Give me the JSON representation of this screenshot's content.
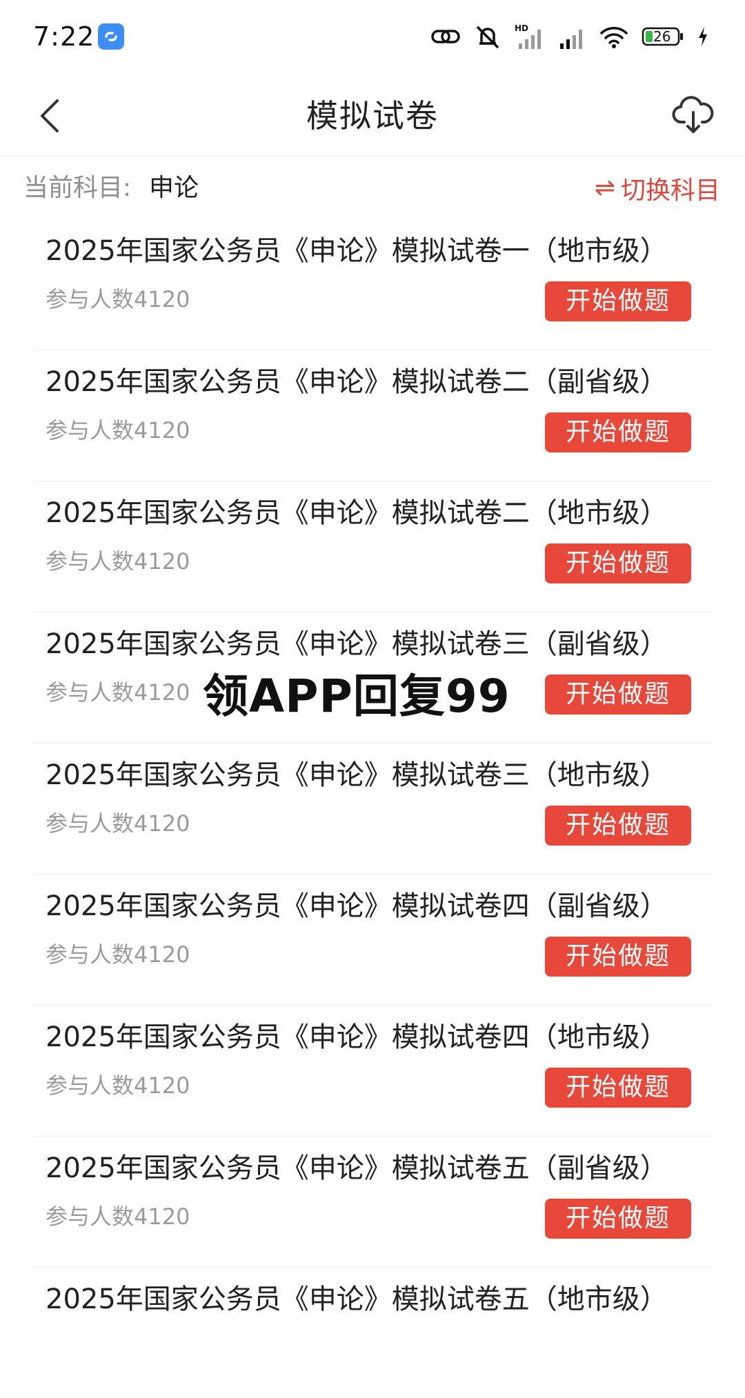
{
  "status_bar": {
    "time": "7:22",
    "battery": "26",
    "network": "HD"
  },
  "header": {
    "title": "模拟试卷"
  },
  "subject": {
    "label": "当前科目:",
    "value": "申论",
    "switch_icon": "⇌",
    "switch_label": "切换科目"
  },
  "exams": [
    {
      "title": "2025年国家公务员《申论》模拟试卷一（地市级）",
      "count": "参与人数4120",
      "button": "开始做题"
    },
    {
      "title": "2025年国家公务员《申论》模拟试卷二（副省级）",
      "count": "参与人数4120",
      "button": "开始做题"
    },
    {
      "title": "2025年国家公务员《申论》模拟试卷二（地市级）",
      "count": "参与人数4120",
      "button": "开始做题"
    },
    {
      "title": "2025年国家公务员《申论》模拟试卷三（副省级）",
      "count": "参与人数4120",
      "button": "开始做题"
    },
    {
      "title": "2025年国家公务员《申论》模拟试卷三（地市级）",
      "count": "参与人数4120",
      "button": "开始做题"
    },
    {
      "title": "2025年国家公务员《申论》模拟试卷四（副省级）",
      "count": "参与人数4120",
      "button": "开始做题"
    },
    {
      "title": "2025年国家公务员《申论》模拟试卷四（地市级）",
      "count": "参与人数4120",
      "button": "开始做题"
    },
    {
      "title": "2025年国家公务员《申论》模拟试卷五（副省级）",
      "count": "参与人数4120",
      "button": "开始做题"
    },
    {
      "title": "2025年国家公务员《申论》模拟试卷五（地市级）",
      "count": "",
      "button": ""
    }
  ],
  "overlay": {
    "text": "领APP回复99"
  },
  "colors": {
    "accent": "#e8483a",
    "muted_text": "#9a9a9a",
    "divider": "#eeeeee"
  }
}
